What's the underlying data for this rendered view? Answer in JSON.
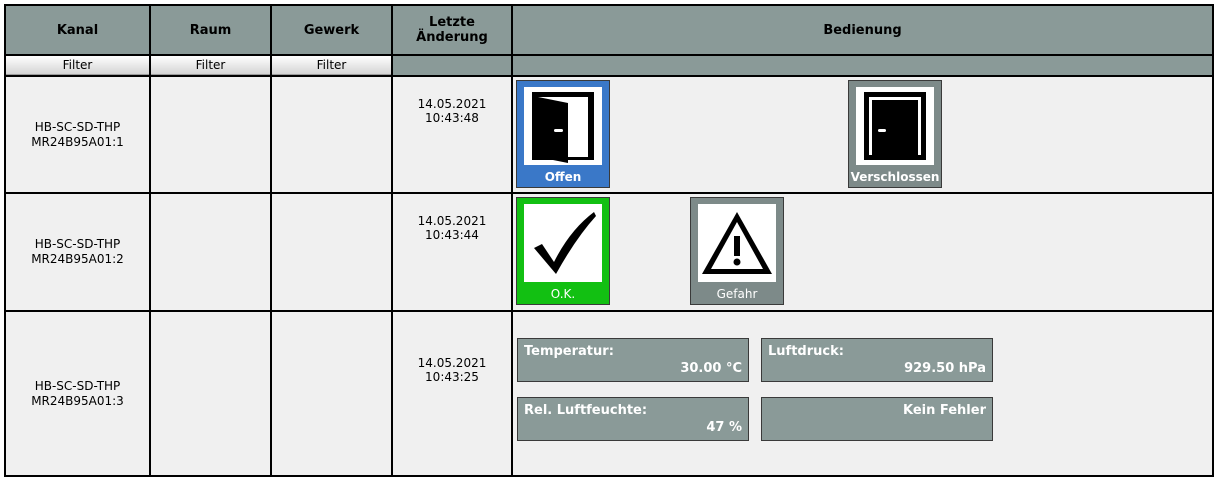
{
  "header": {
    "kanal": "Kanal",
    "raum": "Raum",
    "gewerk": "Gewerk",
    "letzte_1": "Letzte",
    "letzte_2": "Änderung",
    "bedienung": "Bedienung"
  },
  "filters": {
    "kanal": "Filter",
    "raum": "Filter",
    "gewerk": "Filter"
  },
  "rows": [
    {
      "channel_1": "HB-SC-SD-THP",
      "channel_2": "MR24B95A01:1",
      "date": "14.05.2021",
      "time": "10:43:48",
      "buttons": [
        {
          "label": "Offen",
          "icon": "open-door-icon",
          "color": "#3a78c8"
        },
        {
          "label": "Verschlossen",
          "icon": "closed-door-icon",
          "color": "#7d8a89"
        }
      ]
    },
    {
      "channel_1": "HB-SC-SD-THP",
      "channel_2": "MR24B95A01:2",
      "date": "14.05.2021",
      "time": "10:43:44",
      "buttons": [
        {
          "label": "O.K.",
          "icon": "checkmark-icon",
          "color": "#12c012"
        },
        {
          "label": "Gefahr",
          "icon": "warning-icon",
          "color": "#7d8a89"
        }
      ]
    },
    {
      "channel_1": "HB-SC-SD-THP",
      "channel_2": "MR24B95A01:3",
      "date": "14.05.2021",
      "time": "10:43:25",
      "values": {
        "temperature_label": "Temperatur:",
        "temperature_value": "30.00 °C",
        "pressure_label": "Luftdruck:",
        "pressure_value": "929.50 hPa",
        "humidity_label": "Rel. Luftfeuchte:",
        "humidity_value": "47 %",
        "error_status": "Kein Fehler"
      }
    }
  ]
}
